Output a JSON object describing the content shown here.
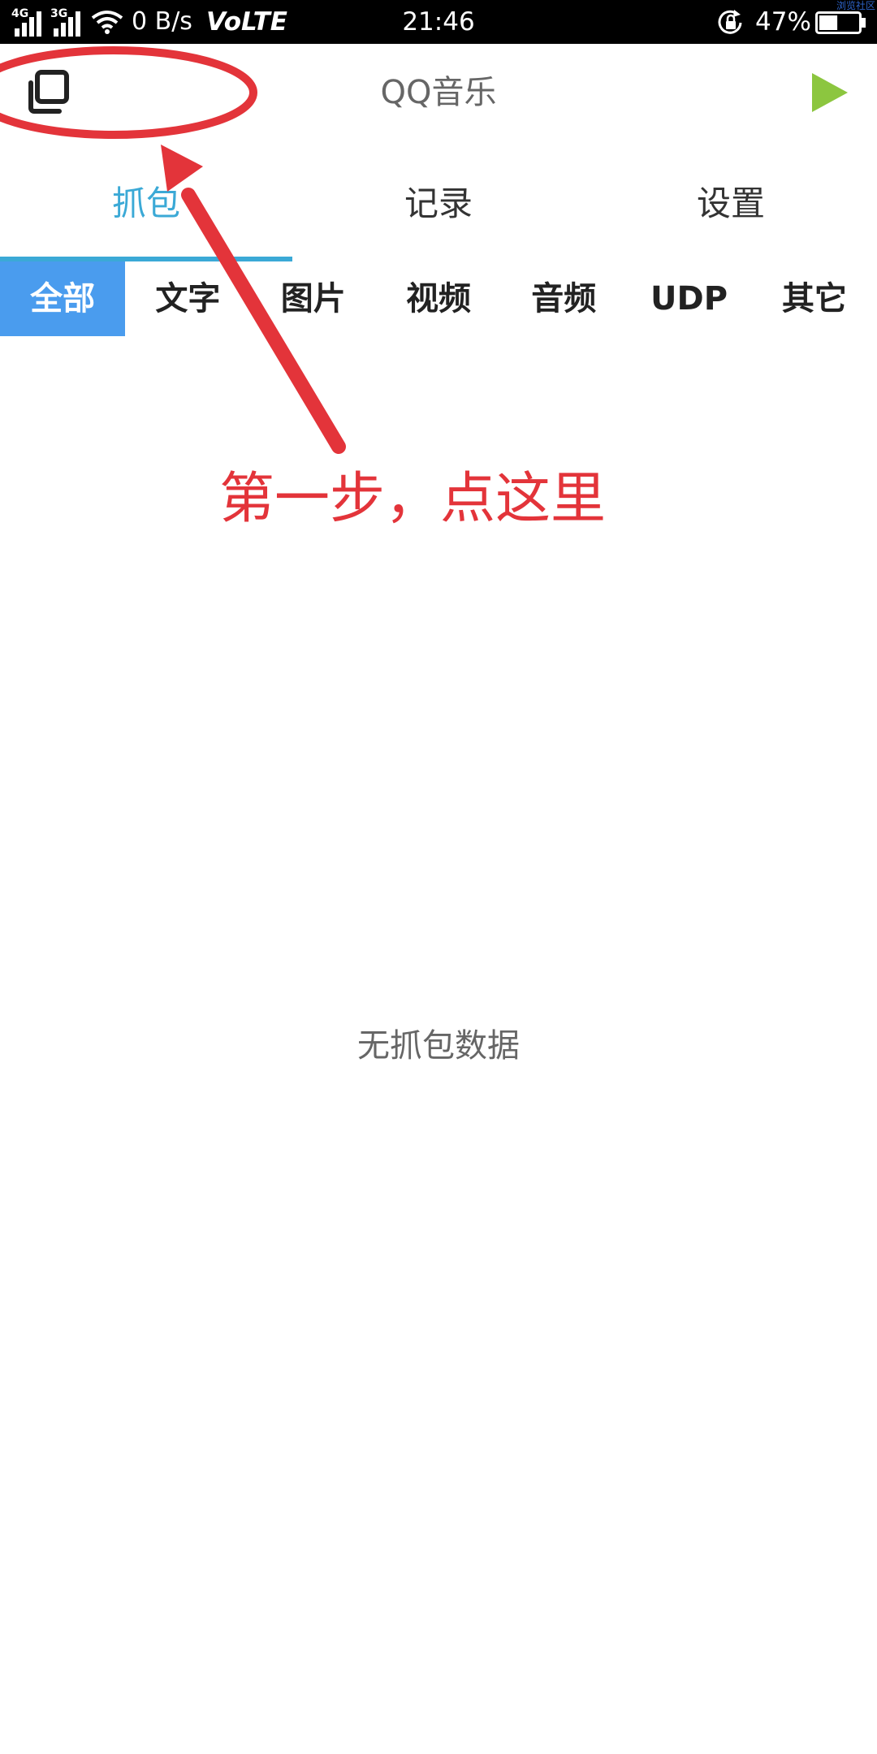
{
  "status_bar": {
    "network_1": "4G",
    "network_2": "3G",
    "speed": "0 B/s",
    "volte": "VoLTE",
    "time": "21:46",
    "battery_percent": "47%",
    "battery_level": 0.47
  },
  "watermark": "浏览社区",
  "header": {
    "copy_icon": "copy-windows-icon",
    "title": "QQ音乐",
    "play_icon": "play-triangle-icon",
    "play_color": "#8cc63f"
  },
  "main_tabs": [
    {
      "label": "抓包",
      "active": true
    },
    {
      "label": "记录",
      "active": false
    },
    {
      "label": "设置",
      "active": false
    }
  ],
  "filter_tabs": [
    {
      "label": "全部",
      "active": true
    },
    {
      "label": "文字",
      "active": false
    },
    {
      "label": "图片",
      "active": false
    },
    {
      "label": "视频",
      "active": false
    },
    {
      "label": "音频",
      "active": false
    },
    {
      "label": "UDP",
      "active": false
    },
    {
      "label": "其它",
      "active": false
    }
  ],
  "empty_state": "无抓包数据",
  "annotation": {
    "text": "第一步，点这里",
    "color": "#e3343a"
  },
  "colors": {
    "accent": "#3ba9d6",
    "filter_active": "#4a9cee"
  }
}
